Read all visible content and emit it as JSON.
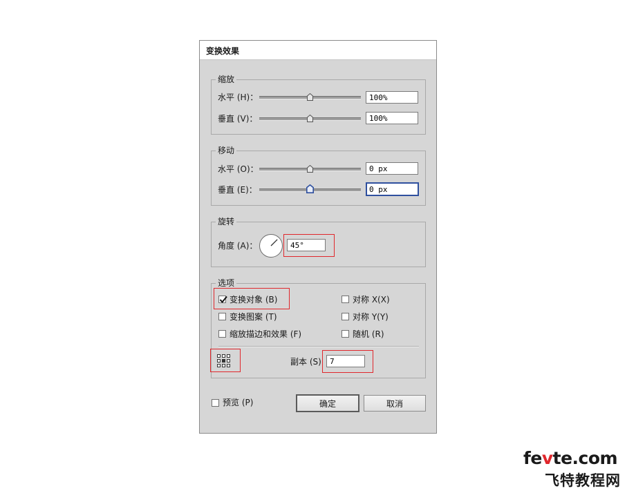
{
  "dialog": {
    "title": "变换效果"
  },
  "scale": {
    "legend": "缩放",
    "horizontal_label": "水平 (H)：",
    "horizontal_value": "100%",
    "horizontal_slider_fraction": 0.5,
    "vertical_label": "垂直 (V)：",
    "vertical_value": "100%",
    "vertical_slider_fraction": 0.5
  },
  "move": {
    "legend": "移动",
    "horizontal_label": "水平 (O)：",
    "horizontal_value": "0 px",
    "horizontal_slider_fraction": 0.5,
    "vertical_label": "垂直 (E)：",
    "vertical_value": "0 px",
    "vertical_slider_fraction": 0.5
  },
  "rotate": {
    "legend": "旋转",
    "angle_label": "角度 (A)：",
    "angle_value": "45°",
    "angle_degrees": 45
  },
  "options": {
    "legend": "选项",
    "transform_objects": {
      "label": "变换对象 (B)",
      "checked": true
    },
    "transform_patterns": {
      "label": "变换图案 (T)",
      "checked": false
    },
    "scale_strokes": {
      "label": "缩放描边和效果 (F)",
      "checked": false
    },
    "reflect_x": {
      "label": "对称 X(X)",
      "checked": false
    },
    "reflect_y": {
      "label": "对称 Y(Y)",
      "checked": false
    },
    "random": {
      "label": "随机 (R)",
      "checked": false
    },
    "copies_label": "副本 (S)",
    "copies_value": "7",
    "reference_point_icon": "reference-point-grid-icon"
  },
  "footer": {
    "preview_label": "预览 (P)",
    "preview_checked": false,
    "ok_label": "确定",
    "cancel_label": "取消"
  },
  "watermark": {
    "site_pre": "fe",
    "site_accent": "v",
    "site_post": "te.com",
    "tagline": "飞特教程网"
  },
  "colors": {
    "highlight_box": "#e0262b",
    "focus_border": "#2e4f9e",
    "dialog_bg": "#d6d6d6"
  }
}
